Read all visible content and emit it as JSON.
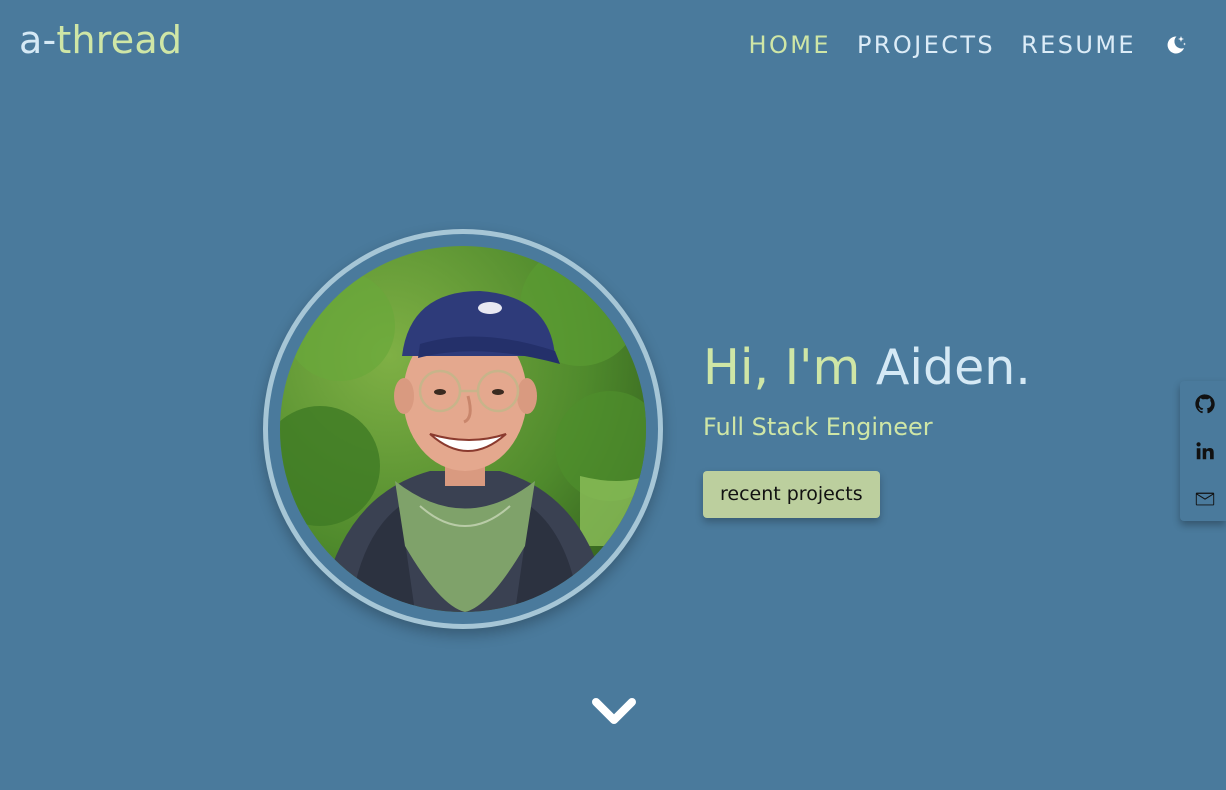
{
  "brand": {
    "prefix": "a-",
    "name": "thread"
  },
  "nav": {
    "items": [
      {
        "label": "HOME",
        "active": true
      },
      {
        "label": "PROJECTS",
        "active": false
      },
      {
        "label": "RESUME",
        "active": false
      }
    ],
    "theme_toggle_icon": "moon-stars-icon"
  },
  "hero": {
    "greeting_prefix": "Hi, I'm ",
    "greeting_name": "Aiden.",
    "subtitle": "Full Stack Engineer",
    "cta_label": "recent projects",
    "portrait_icon": "profile-photo"
  },
  "social": {
    "items": [
      {
        "icon": "github-icon"
      },
      {
        "icon": "linkedin-icon"
      },
      {
        "icon": "email-icon"
      }
    ]
  },
  "scroll_icon": "chevron-down-icon",
  "colors": {
    "background": "#4a7a9c",
    "accent": "#cfe6a6",
    "text_light": "#d5e9f5",
    "button": "#bccf9e",
    "ring": "#a6c6d6"
  }
}
